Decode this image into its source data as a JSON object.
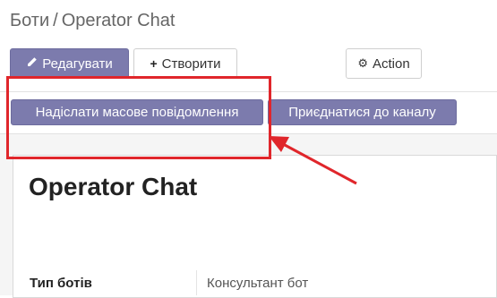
{
  "breadcrumb": {
    "parent": "Боти",
    "separator": "/",
    "current": "Operator Chat"
  },
  "toolbar": {
    "edit_label": "Редагувати",
    "create_label": "Створити",
    "action_label": "Action"
  },
  "header_buttons": {
    "mass_message_label": "Надіслати масове повідомлення",
    "join_channel_label": "Приєднатися до каналу"
  },
  "record": {
    "title": "Operator Chat",
    "fields": [
      {
        "label": "Тип ботів",
        "value": "Консультант бот"
      }
    ]
  },
  "icons": {
    "edit": "pencil-icon",
    "create": "plus-icon",
    "action": "gear-icon"
  },
  "colors": {
    "primary": "#7c7bad",
    "annotation": "#e0262b"
  }
}
